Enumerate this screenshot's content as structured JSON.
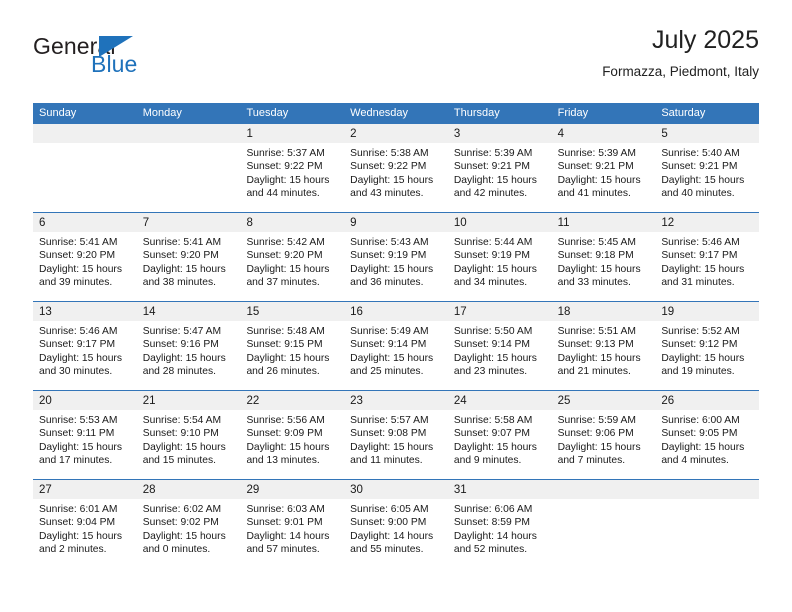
{
  "brand": {
    "name_part1": "General",
    "name_part2": "Blue",
    "flag_icon": "blue-triangle-flag-icon",
    "colors": {
      "text": "#231f20",
      "accent": "#1f72bb"
    }
  },
  "header": {
    "title": "July 2025",
    "subtitle": "Formazza, Piedmont, Italy"
  },
  "theme": {
    "header_blue": "#3375b8",
    "day_band_gray": "#f0f0f0",
    "text": "#1a1a1a"
  },
  "calendar": {
    "weekday_headers": [
      "Sunday",
      "Monday",
      "Tuesday",
      "Wednesday",
      "Thursday",
      "Friday",
      "Saturday"
    ],
    "weeks": [
      [
        {
          "day": "",
          "lines": []
        },
        {
          "day": "",
          "lines": []
        },
        {
          "day": "1",
          "lines": [
            "Sunrise: 5:37 AM",
            "Sunset: 9:22 PM",
            "Daylight: 15 hours",
            "and 44 minutes."
          ]
        },
        {
          "day": "2",
          "lines": [
            "Sunrise: 5:38 AM",
            "Sunset: 9:22 PM",
            "Daylight: 15 hours",
            "and 43 minutes."
          ]
        },
        {
          "day": "3",
          "lines": [
            "Sunrise: 5:39 AM",
            "Sunset: 9:21 PM",
            "Daylight: 15 hours",
            "and 42 minutes."
          ]
        },
        {
          "day": "4",
          "lines": [
            "Sunrise: 5:39 AM",
            "Sunset: 9:21 PM",
            "Daylight: 15 hours",
            "and 41 minutes."
          ]
        },
        {
          "day": "5",
          "lines": [
            "Sunrise: 5:40 AM",
            "Sunset: 9:21 PM",
            "Daylight: 15 hours",
            "and 40 minutes."
          ]
        }
      ],
      [
        {
          "day": "6",
          "lines": [
            "Sunrise: 5:41 AM",
            "Sunset: 9:20 PM",
            "Daylight: 15 hours",
            "and 39 minutes."
          ]
        },
        {
          "day": "7",
          "lines": [
            "Sunrise: 5:41 AM",
            "Sunset: 9:20 PM",
            "Daylight: 15 hours",
            "and 38 minutes."
          ]
        },
        {
          "day": "8",
          "lines": [
            "Sunrise: 5:42 AM",
            "Sunset: 9:20 PM",
            "Daylight: 15 hours",
            "and 37 minutes."
          ]
        },
        {
          "day": "9",
          "lines": [
            "Sunrise: 5:43 AM",
            "Sunset: 9:19 PM",
            "Daylight: 15 hours",
            "and 36 minutes."
          ]
        },
        {
          "day": "10",
          "lines": [
            "Sunrise: 5:44 AM",
            "Sunset: 9:19 PM",
            "Daylight: 15 hours",
            "and 34 minutes."
          ]
        },
        {
          "day": "11",
          "lines": [
            "Sunrise: 5:45 AM",
            "Sunset: 9:18 PM",
            "Daylight: 15 hours",
            "and 33 minutes."
          ]
        },
        {
          "day": "12",
          "lines": [
            "Sunrise: 5:46 AM",
            "Sunset: 9:17 PM",
            "Daylight: 15 hours",
            "and 31 minutes."
          ]
        }
      ],
      [
        {
          "day": "13",
          "lines": [
            "Sunrise: 5:46 AM",
            "Sunset: 9:17 PM",
            "Daylight: 15 hours",
            "and 30 minutes."
          ]
        },
        {
          "day": "14",
          "lines": [
            "Sunrise: 5:47 AM",
            "Sunset: 9:16 PM",
            "Daylight: 15 hours",
            "and 28 minutes."
          ]
        },
        {
          "day": "15",
          "lines": [
            "Sunrise: 5:48 AM",
            "Sunset: 9:15 PM",
            "Daylight: 15 hours",
            "and 26 minutes."
          ]
        },
        {
          "day": "16",
          "lines": [
            "Sunrise: 5:49 AM",
            "Sunset: 9:14 PM",
            "Daylight: 15 hours",
            "and 25 minutes."
          ]
        },
        {
          "day": "17",
          "lines": [
            "Sunrise: 5:50 AM",
            "Sunset: 9:14 PM",
            "Daylight: 15 hours",
            "and 23 minutes."
          ]
        },
        {
          "day": "18",
          "lines": [
            "Sunrise: 5:51 AM",
            "Sunset: 9:13 PM",
            "Daylight: 15 hours",
            "and 21 minutes."
          ]
        },
        {
          "day": "19",
          "lines": [
            "Sunrise: 5:52 AM",
            "Sunset: 9:12 PM",
            "Daylight: 15 hours",
            "and 19 minutes."
          ]
        }
      ],
      [
        {
          "day": "20",
          "lines": [
            "Sunrise: 5:53 AM",
            "Sunset: 9:11 PM",
            "Daylight: 15 hours",
            "and 17 minutes."
          ]
        },
        {
          "day": "21",
          "lines": [
            "Sunrise: 5:54 AM",
            "Sunset: 9:10 PM",
            "Daylight: 15 hours",
            "and 15 minutes."
          ]
        },
        {
          "day": "22",
          "lines": [
            "Sunrise: 5:56 AM",
            "Sunset: 9:09 PM",
            "Daylight: 15 hours",
            "and 13 minutes."
          ]
        },
        {
          "day": "23",
          "lines": [
            "Sunrise: 5:57 AM",
            "Sunset: 9:08 PM",
            "Daylight: 15 hours",
            "and 11 minutes."
          ]
        },
        {
          "day": "24",
          "lines": [
            "Sunrise: 5:58 AM",
            "Sunset: 9:07 PM",
            "Daylight: 15 hours",
            "and 9 minutes."
          ]
        },
        {
          "day": "25",
          "lines": [
            "Sunrise: 5:59 AM",
            "Sunset: 9:06 PM",
            "Daylight: 15 hours",
            "and 7 minutes."
          ]
        },
        {
          "day": "26",
          "lines": [
            "Sunrise: 6:00 AM",
            "Sunset: 9:05 PM",
            "Daylight: 15 hours",
            "and 4 minutes."
          ]
        }
      ],
      [
        {
          "day": "27",
          "lines": [
            "Sunrise: 6:01 AM",
            "Sunset: 9:04 PM",
            "Daylight: 15 hours",
            "and 2 minutes."
          ]
        },
        {
          "day": "28",
          "lines": [
            "Sunrise: 6:02 AM",
            "Sunset: 9:02 PM",
            "Daylight: 15 hours",
            "and 0 minutes."
          ]
        },
        {
          "day": "29",
          "lines": [
            "Sunrise: 6:03 AM",
            "Sunset: 9:01 PM",
            "Daylight: 14 hours",
            "and 57 minutes."
          ]
        },
        {
          "day": "30",
          "lines": [
            "Sunrise: 6:05 AM",
            "Sunset: 9:00 PM",
            "Daylight: 14 hours",
            "and 55 minutes."
          ]
        },
        {
          "day": "31",
          "lines": [
            "Sunrise: 6:06 AM",
            "Sunset: 8:59 PM",
            "Daylight: 14 hours",
            "and 52 minutes."
          ]
        },
        {
          "day": "",
          "lines": []
        },
        {
          "day": "",
          "lines": []
        }
      ]
    ]
  }
}
